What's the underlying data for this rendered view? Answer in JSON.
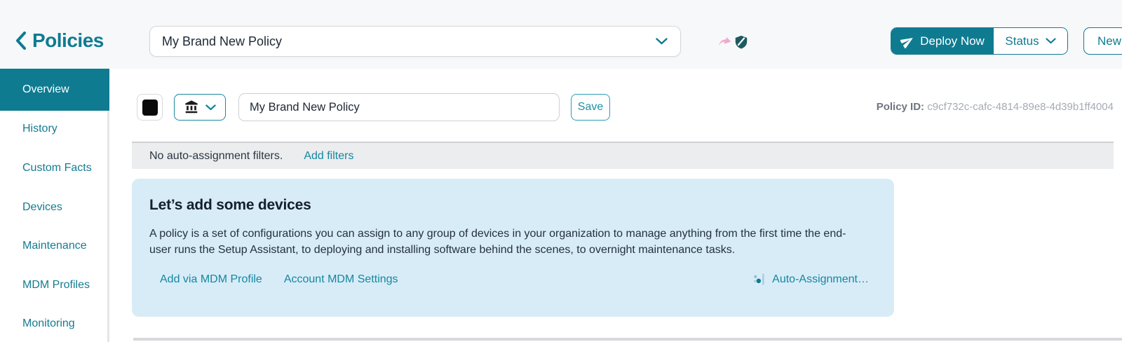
{
  "colors": {
    "teal": "#0f7b91",
    "card_bg": "#d8ecf7",
    "pink_icon": "#f1a9cd",
    "shield_icon": "#1c5b60"
  },
  "header": {
    "back_label": "Policies",
    "policy_selector_value": "My Brand New Policy",
    "deploy_label": "Deploy Now",
    "status_label": "Status",
    "new_label": "New"
  },
  "sidebar": {
    "items": [
      {
        "label": "Overview",
        "active": true
      },
      {
        "label": "History",
        "active": false
      },
      {
        "label": "Custom Facts",
        "active": false
      },
      {
        "label": "Devices",
        "active": false
      },
      {
        "label": "Maintenance",
        "active": false
      },
      {
        "label": "MDM Profiles",
        "active": false
      },
      {
        "label": "Monitoring",
        "active": false
      }
    ]
  },
  "toolbar": {
    "policy_name_value": "My Brand New Policy",
    "save_label": "Save",
    "policy_id_label": "Policy ID:",
    "policy_id_value": "c9cf732c-cafc-4814-89e8-4d39b1ff4004"
  },
  "filter_bar": {
    "message": "No auto-assignment filters.",
    "add_filters_label": "Add filters"
  },
  "devices_card": {
    "title": "Let’s add some devices",
    "body": "A policy is a set of configurations you can assign to any group of devices in your organization to manage anything from the first time the end-user runs the Setup Assistant, to deploying and installing software behind the scenes, to overnight maintenance tasks.",
    "links": [
      "Add via MDM Profile",
      "Account MDM Settings"
    ],
    "auto_assignment_label": "Auto-Assignment…"
  }
}
